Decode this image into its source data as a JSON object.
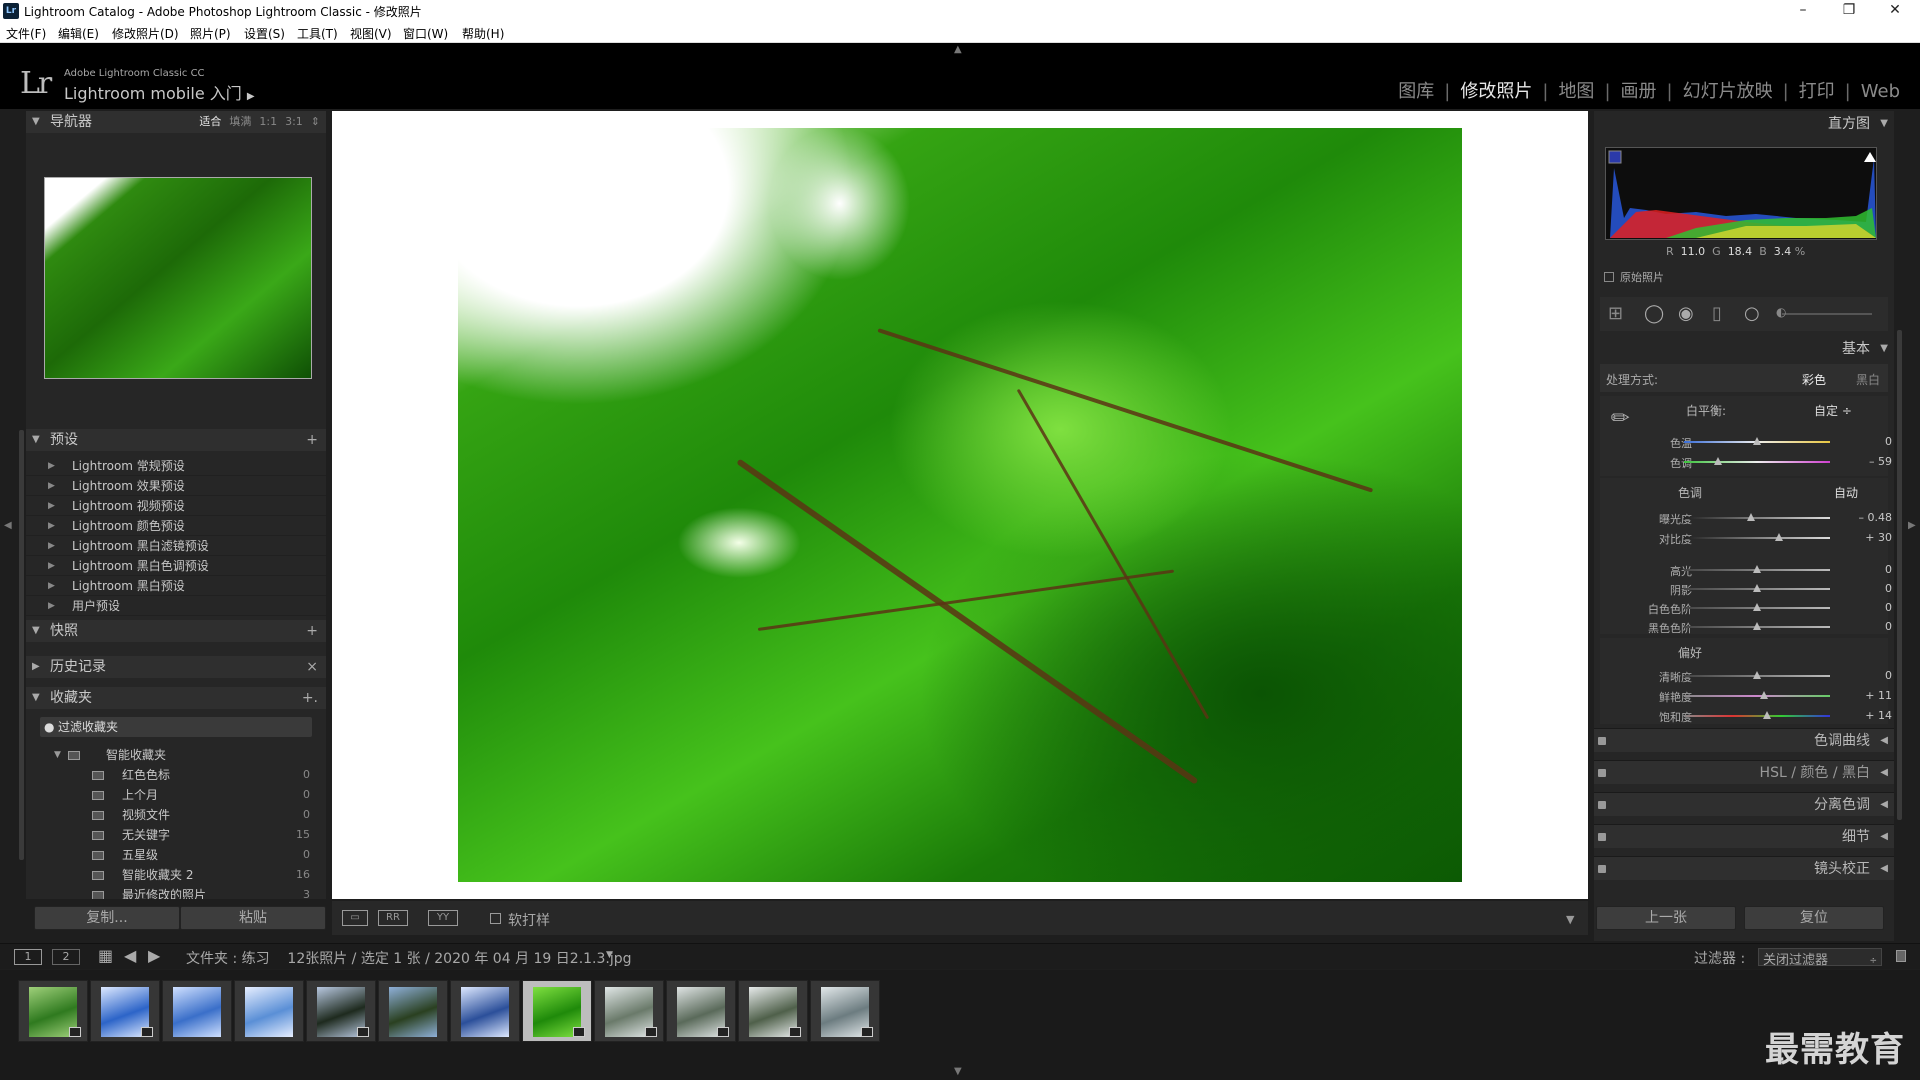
{
  "window": {
    "title": "Lightroom Catalog - Adobe Photoshop Lightroom Classic - 修改照片",
    "app_icon": "Lr",
    "controls": [
      "minimize-icon",
      "restore-icon",
      "close-icon"
    ]
  },
  "menu": [
    "文件(F)",
    "编辑(E)",
    "修改照片(D)",
    "照片(P)",
    "设置(S)",
    "工具(T)",
    "视图(V)",
    "窗口(W)",
    "帮助(H)"
  ],
  "identity": {
    "logo": "Lr",
    "line1": "Adobe Lightroom Classic CC",
    "line2": "Lightroom mobile 入门",
    "arrow": "▶"
  },
  "modules": [
    {
      "label": "图库",
      "active": false
    },
    {
      "label": "修改照片",
      "active": true
    },
    {
      "label": "地图",
      "active": false
    },
    {
      "label": "画册",
      "active": false
    },
    {
      "label": "幻灯片放映",
      "active": false
    },
    {
      "label": "打印",
      "active": false
    },
    {
      "label": "Web",
      "active": false
    }
  ],
  "left": {
    "navigator": {
      "title": "导航器",
      "options": [
        "适合",
        "填满",
        "1:1",
        "3:1"
      ],
      "active": "适合",
      "arrows": "⇕"
    },
    "presets": {
      "title": "预设",
      "add": "+",
      "items": [
        "Lightroom 常规预设",
        "Lightroom 效果预设",
        "Lightroom 视频预设",
        "Lightroom 颜色预设",
        "Lightroom 黑白滤镜预设",
        "Lightroom 黑白色调预设",
        "Lightroom 黑白预设",
        "用户预设"
      ]
    },
    "snapshots": {
      "title": "快照",
      "add": "+"
    },
    "history": {
      "title": "历史记录",
      "close": "×"
    },
    "collections": {
      "title": "收藏夹",
      "add": "+.",
      "filter": "过滤收藏夹",
      "smart_folder": "智能收藏夹",
      "items": [
        {
          "label": "红色色标",
          "count": "0"
        },
        {
          "label": "上个月",
          "count": "0"
        },
        {
          "label": "视频文件",
          "count": "0"
        },
        {
          "label": "无关键字",
          "count": "15"
        },
        {
          "label": "五星级",
          "count": "0"
        },
        {
          "label": "智能收藏夹 2",
          "count": "16"
        },
        {
          "label": "最近修改的照片",
          "count": "3"
        }
      ]
    },
    "buttons": {
      "copy": "复制...",
      "paste": "粘贴"
    }
  },
  "toolbar": {
    "soft_proof": "软打样"
  },
  "right": {
    "histogram": {
      "title": "直方图",
      "readout": {
        "r_label": "R",
        "r": "11.0",
        "g_label": "G",
        "g": "18.4",
        "b_label": "B",
        "b": "3.4",
        "pct": "%"
      },
      "original": "原始照片"
    },
    "basic": {
      "title": "基本",
      "treatment_label": "处理方式:",
      "treatment_color": "彩色",
      "treatment_bw": "黑白",
      "wb_label": "白平衡:",
      "wb_value": "自定 ÷",
      "tone_label": "色调",
      "auto": "自动",
      "presence_label": "偏好",
      "wb_sliders": [
        {
          "label": "色温",
          "value": "0",
          "pos": 0.5
        },
        {
          "label": "色调",
          "value": "– 59",
          "pos": 0.23
        }
      ],
      "tone_sliders": [
        {
          "label": "曝光度",
          "value": "– 0.48",
          "pos": 0.46
        },
        {
          "label": "对比度",
          "value": "+ 30",
          "pos": 0.65
        }
      ],
      "tone2_sliders": [
        {
          "label": "高光",
          "value": "0",
          "pos": 0.5
        },
        {
          "label": "阴影",
          "value": "0",
          "pos": 0.5
        },
        {
          "label": "白色色阶",
          "value": "0",
          "pos": 0.5
        },
        {
          "label": "黑色色阶",
          "value": "0",
          "pos": 0.5
        }
      ],
      "presence_sliders": [
        {
          "label": "清晰度",
          "value": "0",
          "pos": 0.5
        },
        {
          "label": "鲜艳度",
          "value": "+ 11",
          "pos": 0.55
        },
        {
          "label": "饱和度",
          "value": "+ 14",
          "pos": 0.57
        }
      ]
    },
    "panels": [
      "色调曲线",
      "HSL / 颜色 / 黑白",
      "分离色调",
      "细节",
      "镜头校正"
    ],
    "buttons": {
      "previous": "上一张",
      "reset": "复位"
    }
  },
  "filmstrip_bar": {
    "page1": "1",
    "page2": "2",
    "info": "文件夹 : 练习    12张照片 / 选定 1 张 / 2020 年 04 月 19 日2.1.3.jpg",
    "dropdown": "▼",
    "filter_label": "过滤器 :",
    "filter_value": "关闭过滤器"
  },
  "thumbnails": [
    {
      "colors": [
        "#2f7a1f",
        "#9fd07a"
      ],
      "badge": true,
      "selected": false
    },
    {
      "colors": [
        "#2c64c8",
        "#dde9ff"
      ],
      "badge": true,
      "selected": false
    },
    {
      "colors": [
        "#3a6fc9",
        "#cfe0ff"
      ],
      "badge": false,
      "selected": false
    },
    {
      "colors": [
        "#5a8fd6",
        "#e6eeff"
      ],
      "badge": false,
      "selected": false
    },
    {
      "colors": [
        "#1e2a1e",
        "#b8c8e0"
      ],
      "badge": true,
      "selected": false
    },
    {
      "colors": [
        "#2a4020",
        "#8fb0d8"
      ],
      "badge": false,
      "selected": false
    },
    {
      "colors": [
        "#2b4f9a",
        "#dde8ff"
      ],
      "badge": false,
      "selected": false
    },
    {
      "colors": [
        "#1f8a0a",
        "#7fe040"
      ],
      "badge": true,
      "selected": true
    },
    {
      "colors": [
        "#6a7a6a",
        "#e0e6e6"
      ],
      "badge": true,
      "selected": false
    },
    {
      "colors": [
        "#5a6a5a",
        "#dfe4e4"
      ],
      "badge": true,
      "selected": false
    },
    {
      "colors": [
        "#4f604a",
        "#e6eaea"
      ],
      "badge": true,
      "selected": false
    },
    {
      "colors": [
        "#6c7c80",
        "#e2e8ea"
      ],
      "badge": true,
      "selected": false
    }
  ],
  "watermark": "最需教育"
}
